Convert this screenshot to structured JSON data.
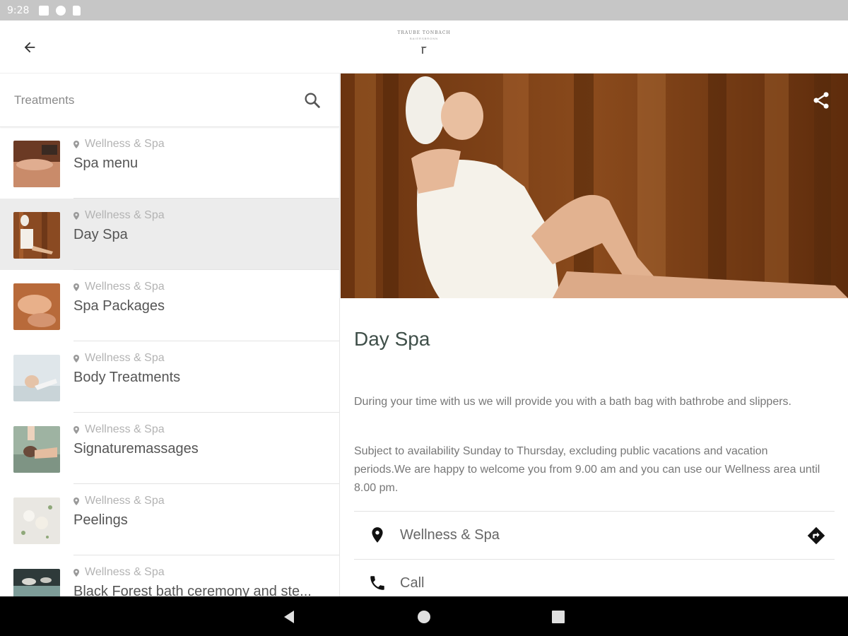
{
  "status_bar": {
    "time": "9:28"
  },
  "app_bar": {
    "back_icon": "arrow-back-icon",
    "logo_line1": "TRAUBE TONBACH",
    "logo_line2": "BAIERSBRONN"
  },
  "search": {
    "placeholder": "Treatments",
    "value": "",
    "icon": "search-icon"
  },
  "list": {
    "items": [
      {
        "category": "Wellness & Spa",
        "title": "Spa menu"
      },
      {
        "category": "Wellness & Spa",
        "title": "Day Spa",
        "selected": true
      },
      {
        "category": "Wellness & Spa",
        "title": "Spa Packages"
      },
      {
        "category": "Wellness & Spa",
        "title": "Body Treatments"
      },
      {
        "category": "Wellness & Spa",
        "title": "Signaturemassages"
      },
      {
        "category": "Wellness & Spa",
        "title": "Peelings"
      },
      {
        "category": "Wellness & Spa",
        "title": "Black Forest bath ceremony and ste..."
      }
    ]
  },
  "detail": {
    "title": "Day Spa",
    "paragraph1": "During your time with us we will provide you with a bath bag with bathrobe and slippers.",
    "paragraph2": "Subject to availability Sunday to Thursday, excluding public vacations and vacation periods.We are happy to welcome you from 9.00 am and you can use our Wellness area until 8.00 pm.",
    "location_label": "Wellness & Spa",
    "call_label": "Call",
    "share_icon": "share-icon",
    "directions_icon": "directions-icon"
  },
  "colors": {
    "title_green": "#3f4f49",
    "selected_bg": "#ececec",
    "nav_bg": "#000000",
    "status_bg": "#c6c6c6"
  }
}
